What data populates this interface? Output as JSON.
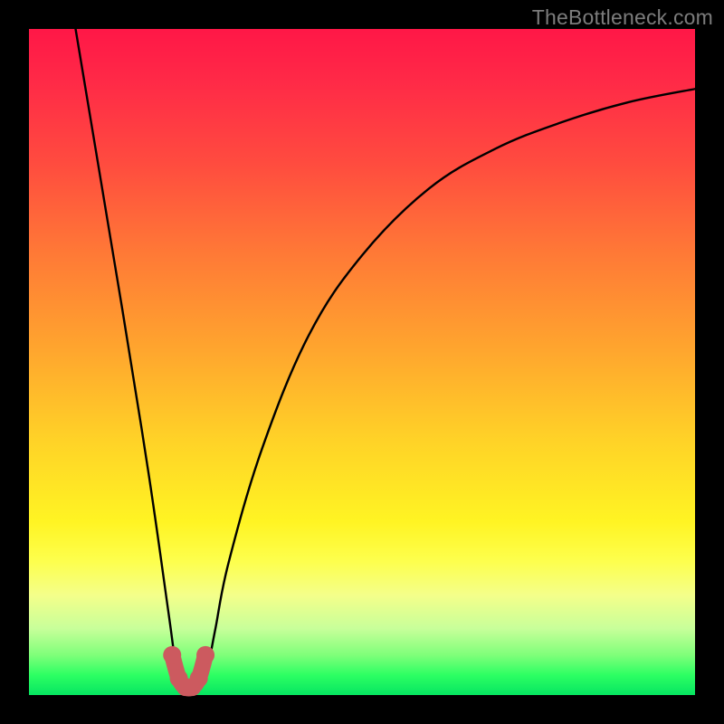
{
  "watermark": "TheBottleneck.com",
  "chart_data": {
    "type": "line",
    "title": "",
    "xlabel": "",
    "ylabel": "",
    "xlim": [
      0,
      100
    ],
    "ylim": [
      0,
      100
    ],
    "series": [
      {
        "name": "bottleneck-curve",
        "x": [
          7,
          10,
          14,
          18,
          21,
          22,
          23,
          24,
          25,
          26,
          27,
          28,
          30,
          35,
          42,
          50,
          60,
          70,
          80,
          90,
          100
        ],
        "y": [
          100,
          82,
          58,
          33,
          12,
          5,
          2,
          1,
          1,
          2,
          5,
          10,
          20,
          37,
          54,
          66,
          76,
          82,
          86,
          89,
          91
        ]
      }
    ],
    "marker_region": {
      "name": "optimal-range",
      "x": [
        21.5,
        22.5,
        23.5,
        24.5,
        25.5,
        26.5
      ],
      "y": [
        6,
        2.5,
        1.2,
        1.2,
        2.5,
        6
      ],
      "color": "#cc5a5f"
    }
  }
}
